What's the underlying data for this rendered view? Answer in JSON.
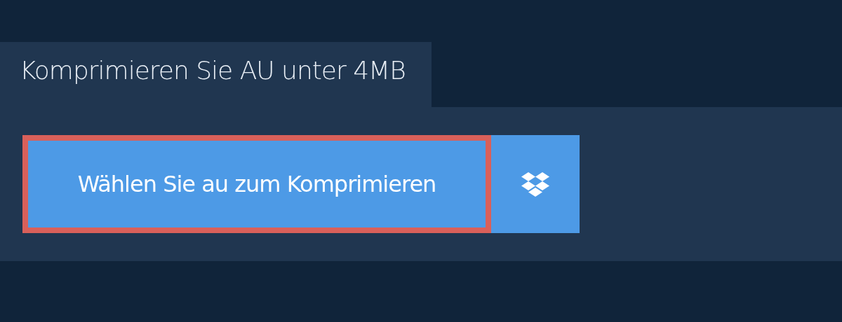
{
  "tab": {
    "label": "Komprimieren Sie AU unter 4MB"
  },
  "upload_button": {
    "label": "Wählen Sie au zum Komprimieren",
    "highlighted": true
  },
  "cloud_button": {
    "kind": "dropbox"
  }
}
